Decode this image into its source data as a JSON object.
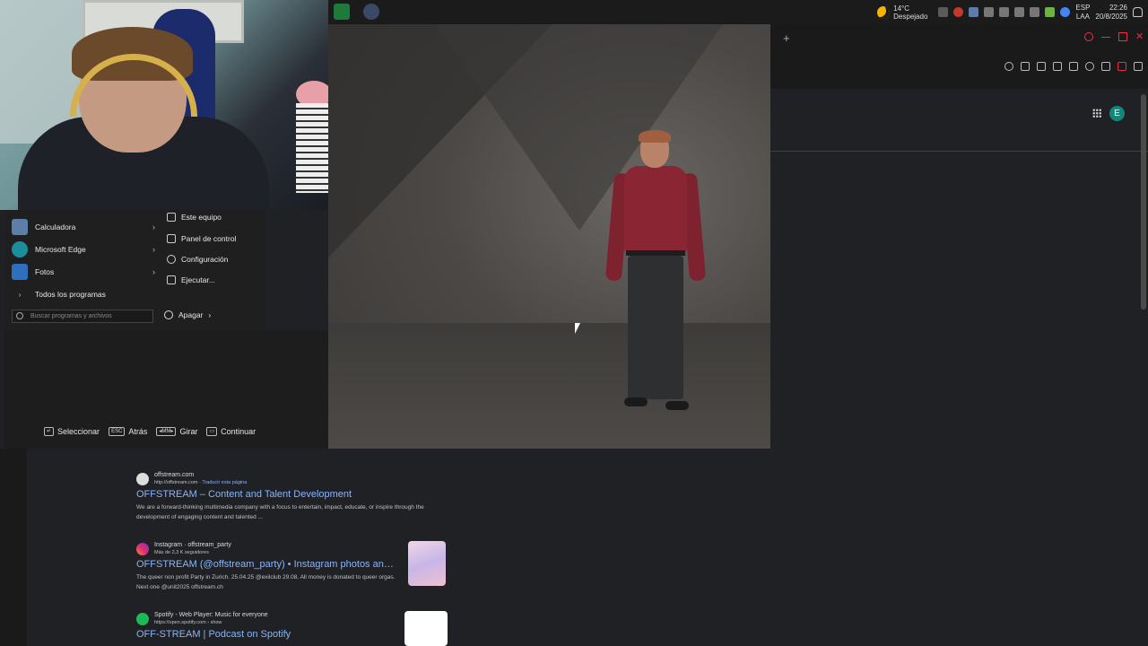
{
  "tray": {
    "temperature": "14°C",
    "weather": "Despejado",
    "lang1": "ESP",
    "lang2": "LAA",
    "time": "22:26",
    "date": "20/8/2025"
  },
  "browser": {
    "newtab_icon": "+",
    "avatar_letter": "E"
  },
  "startmenu": {
    "left_items": [
      {
        "label": "Calculadora",
        "icon": "calculator-icon"
      },
      {
        "label": "Microsoft Edge",
        "icon": "edge-icon"
      },
      {
        "label": "Fotos",
        "icon": "photos-icon"
      }
    ],
    "all_programs": "Todos los programas",
    "right_items": [
      "Este equipo",
      "Panel de control",
      "Configuración",
      "Ejecutar..."
    ],
    "search_placeholder": "Buscar programas y archivos",
    "shutdown": "Apagar"
  },
  "hints": [
    {
      "key": "↵",
      "label": "Seleccionar"
    },
    {
      "key": "ESC",
      "label": "Atrás"
    },
    {
      "key": "◂MM▸",
      "label": "Girar"
    },
    {
      "key": "▭",
      "label": "Continuar"
    }
  ],
  "results": [
    {
      "site": "offstream.com",
      "url": "http://offstream.com",
      "translate": "Traducir esta página",
      "title": "OFFSTREAM – Content and Talent Development",
      "snippet": "We are a forward-thinking multimedia company with a focus to entertain, impact, educate, or inspire through the development of engaging content and talented ..."
    },
    {
      "site": "Instagram · offstream_party",
      "url": "Más de 2,3 K seguidores",
      "translate": "",
      "title": "OFFSTREAM (@offstream_party) • Instagram photos and ...",
      "snippet": "The queer non profit Party in Zurich. 25.04.25 @exilclub 29.08. All money is donated to queer orgas. Next one @unit2025 offstream.ch"
    },
    {
      "site": "Spotify - Web Player: Music for everyone",
      "url": "https://open.spotify.com › show",
      "translate": "",
      "title": "OFF-STREAM | Podcast on Spotify",
      "snippet": ""
    }
  ],
  "colors": {
    "accent_link": "#8ab4f8",
    "avatar": "#11877a",
    "shirt": "#8a2533",
    "browser_red_icons": "#e8304a"
  }
}
